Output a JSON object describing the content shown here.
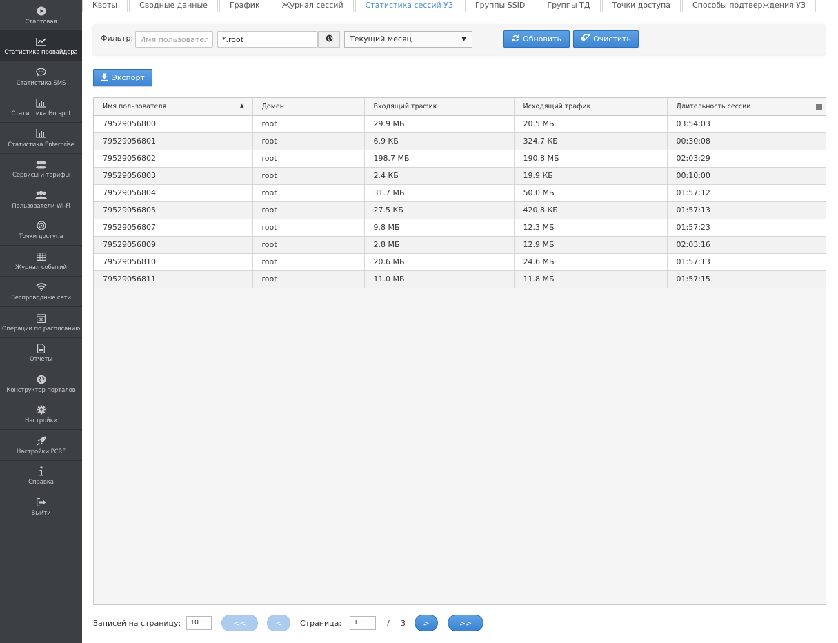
{
  "sidebar": {
    "items": [
      {
        "label": "Стартовая",
        "icon": "play-circle-icon"
      },
      {
        "label": "Статистика провайдера",
        "icon": "line-chart-icon",
        "active": true
      },
      {
        "label": "Статистика SMS",
        "icon": "chat-bubble-icon"
      },
      {
        "label": "Статистика Hotspot",
        "icon": "bar-chart-icon"
      },
      {
        "label": "Статистика Enterprise",
        "icon": "bar-chart-icon"
      },
      {
        "label": "Сервисы и тарифы",
        "icon": "users-icon"
      },
      {
        "label": "Пользователи Wi-Fi",
        "icon": "users-icon"
      },
      {
        "label": "Точки доступа",
        "icon": "target-icon"
      },
      {
        "label": "Журнал событий",
        "icon": "table-icon"
      },
      {
        "label": "Беспроводные сети",
        "icon": "wifi-icon"
      },
      {
        "label": "Операции по расписанию",
        "icon": "calendar-x-icon"
      },
      {
        "label": "Отчеты",
        "icon": "document-icon"
      },
      {
        "label": "Конструктор порталов",
        "icon": "globe-icon"
      },
      {
        "label": "Настройки",
        "icon": "gear-icon"
      },
      {
        "label": "Настройки PCRF",
        "icon": "rocket-icon"
      },
      {
        "label": "Справка",
        "icon": "info-icon"
      },
      {
        "label": "Выйти",
        "icon": "logout-icon"
      }
    ]
  },
  "tabs": [
    {
      "label": "Квоты"
    },
    {
      "label": "Сводные данные"
    },
    {
      "label": "График"
    },
    {
      "label": "Журнал сессий"
    },
    {
      "label": "Статистика сессий УЗ",
      "active": true
    },
    {
      "label": "Группы SSID"
    },
    {
      "label": "Группы ТД"
    },
    {
      "label": "Точки доступа"
    },
    {
      "label": "Способы подтверждения УЗ"
    }
  ],
  "filter": {
    "label": "Фильтр:",
    "username_placeholder": "Имя пользователя",
    "domain_value": "*.root",
    "period_value": "Текущий месяц",
    "refresh_label": "Обновить",
    "clear_label": "Очистить"
  },
  "export_label": "Экспорт",
  "table": {
    "columns": [
      "Имя пользователя",
      "Домен",
      "Входящий трафик",
      "Исходящий трафик",
      "Длительность сессии"
    ],
    "sort_indicator": "▲",
    "rows": [
      [
        "79529056800",
        "root",
        "29.9 МБ",
        "20.5 МБ",
        "03:54:03"
      ],
      [
        "79529056801",
        "root",
        "6.9 КБ",
        "324.7 КБ",
        "00:30:08"
      ],
      [
        "79529056802",
        "root",
        "198.7 МБ",
        "190.8 МБ",
        "02:03:29"
      ],
      [
        "79529056803",
        "root",
        "2.4 КБ",
        "19.9 КБ",
        "00:10:00"
      ],
      [
        "79529056804",
        "root",
        "31.7 МБ",
        "50.0 МБ",
        "01:57:12"
      ],
      [
        "79529056805",
        "root",
        "27.5 КБ",
        "420.8 КБ",
        "01:57:13"
      ],
      [
        "79529056807",
        "root",
        "9.8 МБ",
        "12.3 МБ",
        "01:57:23"
      ],
      [
        "79529056809",
        "root",
        "2.8 МБ",
        "12.9 МБ",
        "02:03:16"
      ],
      [
        "79529056810",
        "root",
        "20.6 МБ",
        "24.6 МБ",
        "01:57:13"
      ],
      [
        "79529056811",
        "root",
        "11.0 МБ",
        "11.8 МБ",
        "01:57:15"
      ]
    ]
  },
  "pager": {
    "per_page_label": "Записей на страницу:",
    "per_page_value": "10",
    "first_label": "<<",
    "prev_label": "<",
    "page_label": "Страница:",
    "page_value": "1",
    "separator": "/",
    "total_pages": "3",
    "next_label": ">",
    "last_label": ">>"
  },
  "colors": {
    "sidebar_bg": "#3d4043",
    "accent": "#4a90d9",
    "button_blue": "#3d86d4"
  }
}
